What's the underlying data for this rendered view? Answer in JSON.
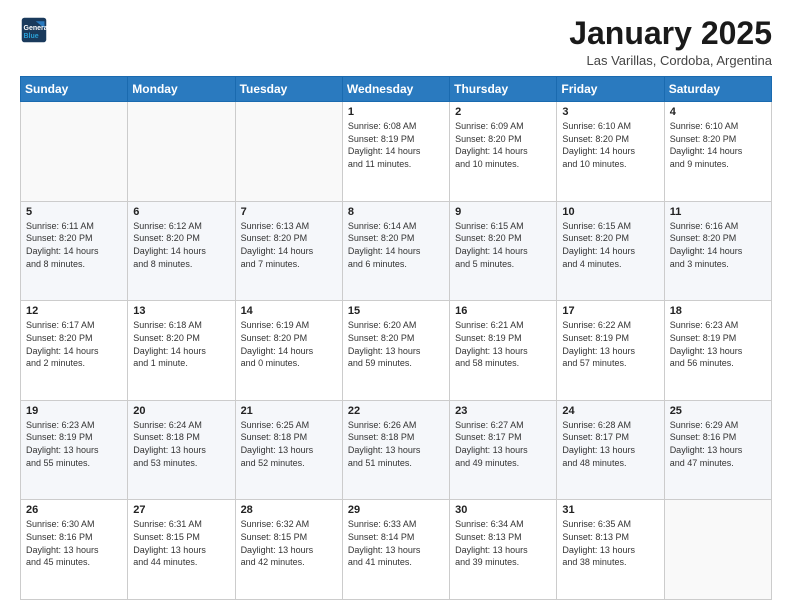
{
  "header": {
    "logo_line1": "General",
    "logo_line2": "Blue",
    "month": "January 2025",
    "location": "Las Varillas, Cordoba, Argentina"
  },
  "weekdays": [
    "Sunday",
    "Monday",
    "Tuesday",
    "Wednesday",
    "Thursday",
    "Friday",
    "Saturday"
  ],
  "weeks": [
    [
      {
        "day": "",
        "text": ""
      },
      {
        "day": "",
        "text": ""
      },
      {
        "day": "",
        "text": ""
      },
      {
        "day": "1",
        "text": "Sunrise: 6:08 AM\nSunset: 8:19 PM\nDaylight: 14 hours\nand 11 minutes."
      },
      {
        "day": "2",
        "text": "Sunrise: 6:09 AM\nSunset: 8:20 PM\nDaylight: 14 hours\nand 10 minutes."
      },
      {
        "day": "3",
        "text": "Sunrise: 6:10 AM\nSunset: 8:20 PM\nDaylight: 14 hours\nand 10 minutes."
      },
      {
        "day": "4",
        "text": "Sunrise: 6:10 AM\nSunset: 8:20 PM\nDaylight: 14 hours\nand 9 minutes."
      }
    ],
    [
      {
        "day": "5",
        "text": "Sunrise: 6:11 AM\nSunset: 8:20 PM\nDaylight: 14 hours\nand 8 minutes."
      },
      {
        "day": "6",
        "text": "Sunrise: 6:12 AM\nSunset: 8:20 PM\nDaylight: 14 hours\nand 8 minutes."
      },
      {
        "day": "7",
        "text": "Sunrise: 6:13 AM\nSunset: 8:20 PM\nDaylight: 14 hours\nand 7 minutes."
      },
      {
        "day": "8",
        "text": "Sunrise: 6:14 AM\nSunset: 8:20 PM\nDaylight: 14 hours\nand 6 minutes."
      },
      {
        "day": "9",
        "text": "Sunrise: 6:15 AM\nSunset: 8:20 PM\nDaylight: 14 hours\nand 5 minutes."
      },
      {
        "day": "10",
        "text": "Sunrise: 6:15 AM\nSunset: 8:20 PM\nDaylight: 14 hours\nand 4 minutes."
      },
      {
        "day": "11",
        "text": "Sunrise: 6:16 AM\nSunset: 8:20 PM\nDaylight: 14 hours\nand 3 minutes."
      }
    ],
    [
      {
        "day": "12",
        "text": "Sunrise: 6:17 AM\nSunset: 8:20 PM\nDaylight: 14 hours\nand 2 minutes."
      },
      {
        "day": "13",
        "text": "Sunrise: 6:18 AM\nSunset: 8:20 PM\nDaylight: 14 hours\nand 1 minute."
      },
      {
        "day": "14",
        "text": "Sunrise: 6:19 AM\nSunset: 8:20 PM\nDaylight: 14 hours\nand 0 minutes."
      },
      {
        "day": "15",
        "text": "Sunrise: 6:20 AM\nSunset: 8:20 PM\nDaylight: 13 hours\nand 59 minutes."
      },
      {
        "day": "16",
        "text": "Sunrise: 6:21 AM\nSunset: 8:19 PM\nDaylight: 13 hours\nand 58 minutes."
      },
      {
        "day": "17",
        "text": "Sunrise: 6:22 AM\nSunset: 8:19 PM\nDaylight: 13 hours\nand 57 minutes."
      },
      {
        "day": "18",
        "text": "Sunrise: 6:23 AM\nSunset: 8:19 PM\nDaylight: 13 hours\nand 56 minutes."
      }
    ],
    [
      {
        "day": "19",
        "text": "Sunrise: 6:23 AM\nSunset: 8:19 PM\nDaylight: 13 hours\nand 55 minutes."
      },
      {
        "day": "20",
        "text": "Sunrise: 6:24 AM\nSunset: 8:18 PM\nDaylight: 13 hours\nand 53 minutes."
      },
      {
        "day": "21",
        "text": "Sunrise: 6:25 AM\nSunset: 8:18 PM\nDaylight: 13 hours\nand 52 minutes."
      },
      {
        "day": "22",
        "text": "Sunrise: 6:26 AM\nSunset: 8:18 PM\nDaylight: 13 hours\nand 51 minutes."
      },
      {
        "day": "23",
        "text": "Sunrise: 6:27 AM\nSunset: 8:17 PM\nDaylight: 13 hours\nand 49 minutes."
      },
      {
        "day": "24",
        "text": "Sunrise: 6:28 AM\nSunset: 8:17 PM\nDaylight: 13 hours\nand 48 minutes."
      },
      {
        "day": "25",
        "text": "Sunrise: 6:29 AM\nSunset: 8:16 PM\nDaylight: 13 hours\nand 47 minutes."
      }
    ],
    [
      {
        "day": "26",
        "text": "Sunrise: 6:30 AM\nSunset: 8:16 PM\nDaylight: 13 hours\nand 45 minutes."
      },
      {
        "day": "27",
        "text": "Sunrise: 6:31 AM\nSunset: 8:15 PM\nDaylight: 13 hours\nand 44 minutes."
      },
      {
        "day": "28",
        "text": "Sunrise: 6:32 AM\nSunset: 8:15 PM\nDaylight: 13 hours\nand 42 minutes."
      },
      {
        "day": "29",
        "text": "Sunrise: 6:33 AM\nSunset: 8:14 PM\nDaylight: 13 hours\nand 41 minutes."
      },
      {
        "day": "30",
        "text": "Sunrise: 6:34 AM\nSunset: 8:13 PM\nDaylight: 13 hours\nand 39 minutes."
      },
      {
        "day": "31",
        "text": "Sunrise: 6:35 AM\nSunset: 8:13 PM\nDaylight: 13 hours\nand 38 minutes."
      },
      {
        "day": "",
        "text": ""
      }
    ]
  ]
}
